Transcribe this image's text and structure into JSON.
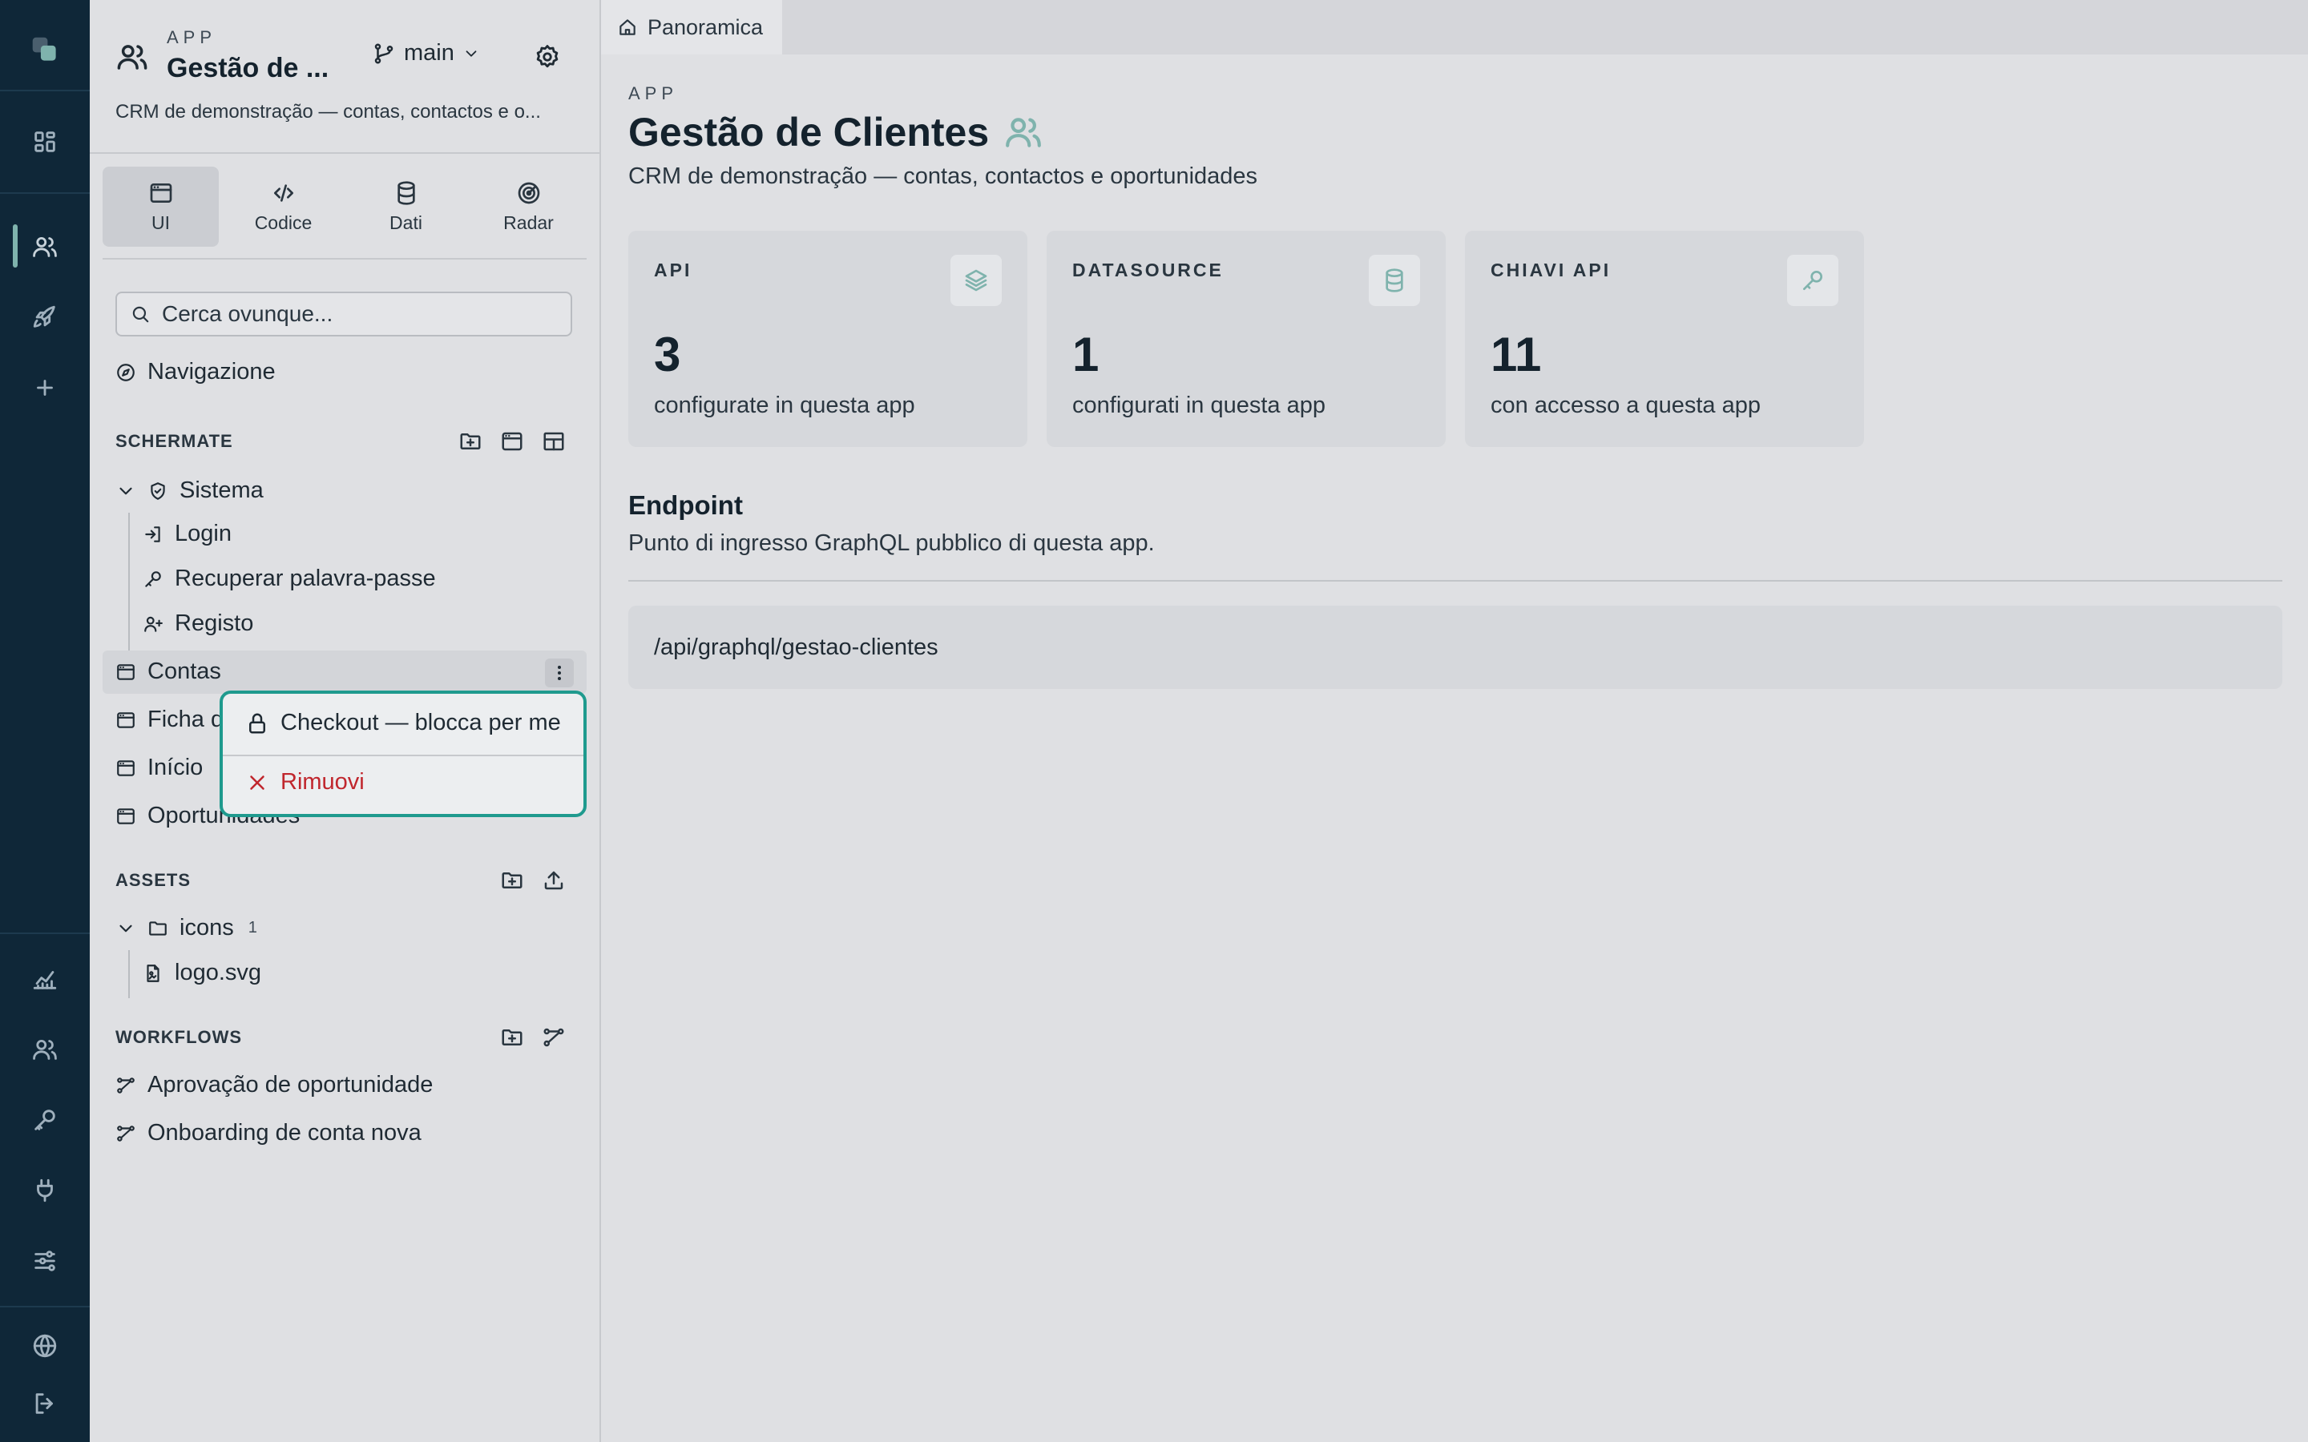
{
  "sidebar": {
    "app_label": "APP",
    "app_title": "Gestão de ...",
    "branch": "main",
    "app_description": "CRM de demonstração — contas, contactos e o...",
    "tabs": [
      {
        "label": "UI",
        "icon": "window-icon",
        "active": true
      },
      {
        "label": "Codice",
        "icon": "code-icon"
      },
      {
        "label": "Dati",
        "icon": "database-icon"
      },
      {
        "label": "Radar",
        "icon": "radar-icon"
      }
    ],
    "search_placeholder": "Cerca ovunque...",
    "navigation_label": "Navigazione",
    "screens": {
      "title": "SCHERMATE",
      "folder": "Sistema",
      "folder_items": [
        "Login",
        "Recuperar palavra-passe",
        "Registo"
      ],
      "items": [
        "Contas",
        "Ficha de conta",
        "Início",
        "Oportunidades"
      ]
    },
    "assets": {
      "title": "ASSETS",
      "folder": "icons",
      "folder_count": "1",
      "file": "logo.svg"
    },
    "workflows": {
      "title": "WORKFLOWS",
      "items": [
        "Aprovação de oportunidade",
        "Onboarding de conta nova"
      ]
    }
  },
  "context_menu": {
    "checkout": "Checkout — blocca per me",
    "remove": "Rimuovi"
  },
  "main": {
    "tab_label": "Panoramica",
    "app_label": "APP",
    "title": "Gestão de Clientes",
    "subtitle": "CRM de demonstração — contas, contactos e oportunidades",
    "cards": [
      {
        "label": "API",
        "value": "3",
        "caption": "configurate in questa app",
        "icon": "layers-icon"
      },
      {
        "label": "DATASOURCE",
        "value": "1",
        "caption": "configurati in questa app",
        "icon": "database-icon"
      },
      {
        "label": "CHIAVI API",
        "value": "11",
        "caption": "con accesso a questa app",
        "icon": "key-icon"
      }
    ],
    "endpoint": {
      "title": "Endpoint",
      "subtitle": "Punto di ingresso GraphQL pubblico di questa app.",
      "url": "/api/graphql/gestao-clientes"
    }
  },
  "colors": {
    "rail_bg": "#0f2738",
    "accent": "#1f9a8e",
    "accent_soft": "#7fb3ad",
    "danger": "#c0262d"
  }
}
